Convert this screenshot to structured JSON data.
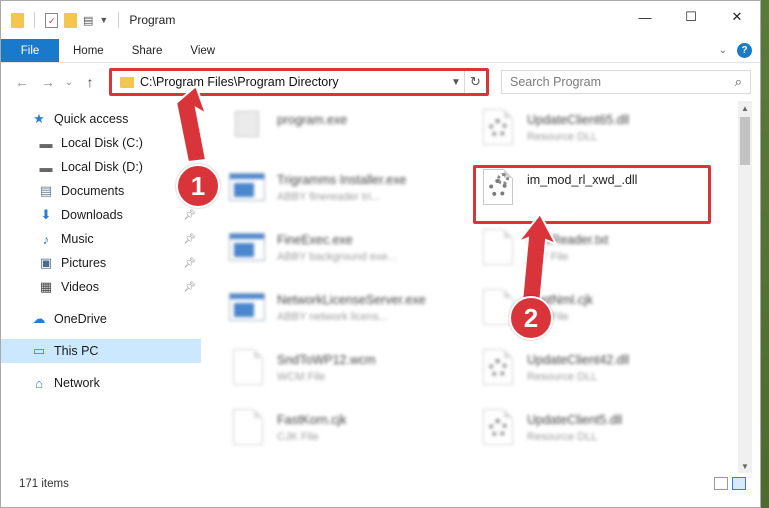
{
  "window": {
    "title": "Program",
    "controls": {
      "minimize": "—",
      "maximize": "☐",
      "close": "✕"
    }
  },
  "ribbon": {
    "tabs": [
      "File",
      "Home",
      "Share",
      "View"
    ]
  },
  "nav": {
    "back": "←",
    "forward": "→",
    "recent": "⌄",
    "up": "↑",
    "address": "C:\\Program Files\\Program Directory",
    "search_placeholder": "Search Program"
  },
  "sidebar": {
    "items": [
      {
        "label": "Quick access",
        "icon": "star-icon",
        "pinned": false
      },
      {
        "label": "Local Disk (C:)",
        "icon": "drive-icon",
        "pinned": false
      },
      {
        "label": "Local Disk (D:)",
        "icon": "drive-icon",
        "pinned": false
      },
      {
        "label": "Documents",
        "icon": "documents-icon",
        "pinned": false
      },
      {
        "label": "Downloads",
        "icon": "downloads-icon",
        "pinned": true
      },
      {
        "label": "Music",
        "icon": "music-icon",
        "pinned": true
      },
      {
        "label": "Pictures",
        "icon": "pictures-icon",
        "pinned": true
      },
      {
        "label": "Videos",
        "icon": "videos-icon",
        "pinned": true
      },
      {
        "label": "OneDrive",
        "icon": "onedrive-icon",
        "pinned": false
      },
      {
        "label": "This PC",
        "icon": "pc-icon",
        "pinned": false
      },
      {
        "label": "Network",
        "icon": "network-icon",
        "pinned": false
      }
    ]
  },
  "files": [
    {
      "name": "program.exe",
      "sub": "",
      "kind": "exe"
    },
    {
      "name": "UpdateClient65.dll",
      "sub": "Resource DLL",
      "kind": "dll"
    },
    {
      "name": "Trigramms Installer.exe",
      "sub": "ABBY finereader tri...",
      "kind": "exe"
    },
    {
      "name": "im_mod_rl_xwd_.dll",
      "sub": "",
      "kind": "dll"
    },
    {
      "name": "FineExec.exe",
      "sub": "ABBY background exe...",
      "kind": "exe"
    },
    {
      "name": "FineReader.txt",
      "sub": "TXT File",
      "kind": "doc"
    },
    {
      "name": "NetworkLicenseServer.exe",
      "sub": "ABBY network licens...",
      "kind": "exe"
    },
    {
      "name": "FontNml.cjk",
      "sub": "CJK File",
      "kind": "doc"
    },
    {
      "name": "SndToWP12.wcm",
      "sub": "WCM File",
      "kind": "doc"
    },
    {
      "name": "UpdateClient42.dll",
      "sub": "Resource DLL",
      "kind": "dll"
    },
    {
      "name": "FastKorn.cjk",
      "sub": "CJK File",
      "kind": "doc"
    },
    {
      "name": "UpdateClient5.dll",
      "sub": "Resource DLL",
      "kind": "dll"
    }
  ],
  "status": {
    "item_count": "171 items"
  },
  "callouts": [
    "1",
    "2"
  ],
  "colors": {
    "accent": "#1979ca",
    "highlight": "#d9343a",
    "selected": "#cce8ff"
  }
}
